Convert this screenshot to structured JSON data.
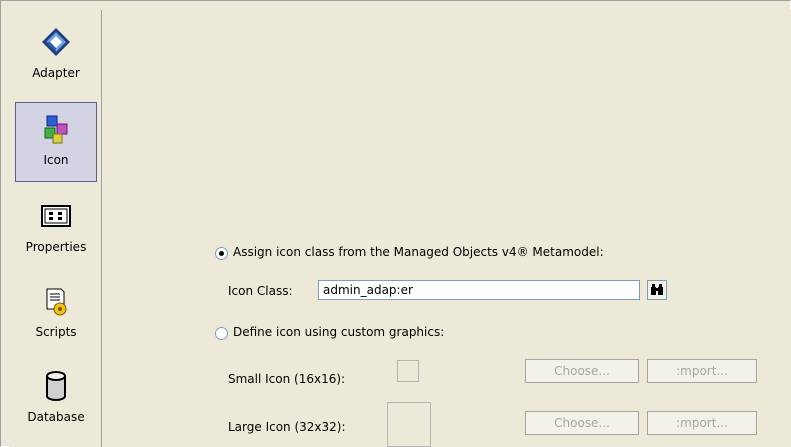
{
  "nav": {
    "items": [
      {
        "label": "Adapter",
        "icon": "adapter-icon"
      },
      {
        "label": "Icon",
        "icon": "icon-puzzle-icon",
        "selected": true
      },
      {
        "label": "Properties",
        "icon": "properties-icon"
      },
      {
        "label": "Scripts",
        "icon": "scripts-icon"
      },
      {
        "label": "Database",
        "icon": "database-icon"
      }
    ]
  },
  "icon_source": {
    "assign_label": "Assign icon class from the Managed Objects v4® Metamodel:",
    "assign_selected": true,
    "icon_class_label": "Icon Class:",
    "icon_class_value": "admin_adap:er",
    "find_icon": "binoculars-icon",
    "custom_label": "Define icon using custom graphics:",
    "custom_selected": false,
    "small_icon_label": "Small Icon (16x16):",
    "large_icon_label": "Large Icon (32x32):",
    "choose_label": "Choose...",
    "import_label": ":mport..."
  },
  "colors": {
    "background": "#ece9d8",
    "selected_nav": "#d4d3e3",
    "disabled_text": "#aca899"
  }
}
